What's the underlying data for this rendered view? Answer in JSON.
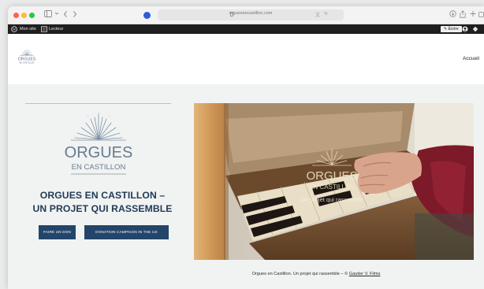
{
  "browser": {
    "url": "orguesencastillon.com",
    "icons": {
      "sidebar": "sidebar-icon",
      "back": "chevron-left-icon",
      "forward": "chevron-right-icon",
      "shield": "shield-icon",
      "share": "share-icon",
      "new_tab": "plus-icon",
      "tabs": "tabs-icon"
    }
  },
  "adminbar": {
    "site_label": "Mon site",
    "reader_label": "Lecteur",
    "write_label": "Écrire"
  },
  "header": {
    "nav_home": "Accueil",
    "logo_small_line1": "ORGUES",
    "logo_small_line2": "EN CASTILLON"
  },
  "hero": {
    "logo_line1": "ORGUES",
    "logo_line2": "EN CASTILLON",
    "title_line1": "ORGUES EN CASTILLON –",
    "title_line2": "UN PROJET QUI RASSEMBLE",
    "button_don": "FAIRE UN DON",
    "button_campaign": "DONATION CAMPAIGN IN THE US",
    "photo_overlay_line1": "ORGUES",
    "photo_overlay_line2": "EN CASTILLON",
    "photo_overlay_tagline": "Un projet qui rassemble"
  },
  "caption": {
    "text": "Orgues en Castillon. Un projet qui rassemble – © ",
    "link": "Gautier V. Films"
  },
  "colors": {
    "brand_navy": "#23456a",
    "title_navy": "#1f3a55",
    "hero_bg": "#f1f3f2",
    "adminbar_bg": "#1f1f1f"
  }
}
